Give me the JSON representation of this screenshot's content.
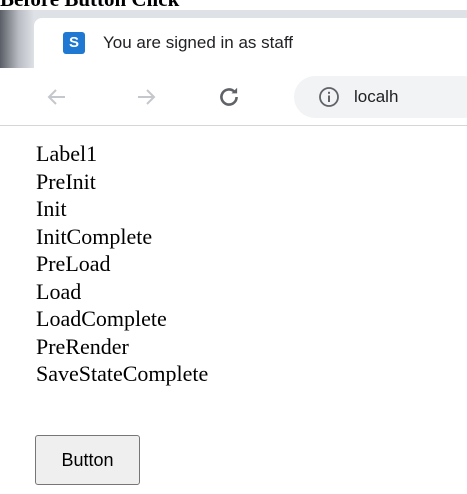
{
  "caption": "Before Button Click",
  "browser": {
    "tab": {
      "favicon_letter": "S",
      "title": "You are signed in as staff"
    },
    "address_bar": {
      "url": "localh"
    },
    "icons": [
      "back-arrow-icon",
      "forward-arrow-icon",
      "reload-icon",
      "info-icon"
    ]
  },
  "page": {
    "events": [
      "Label1",
      "PreInit",
      "Init",
      "InitComplete",
      "PreLoad",
      "Load",
      "LoadComplete",
      "PreRender",
      "SaveStateComplete"
    ],
    "button_label": "Button"
  },
  "colors": {
    "tab_strip": "#dee1e6",
    "favicon": "#1f78d1",
    "omnibox": "#f1f3f4",
    "button_bg": "#efefef"
  }
}
